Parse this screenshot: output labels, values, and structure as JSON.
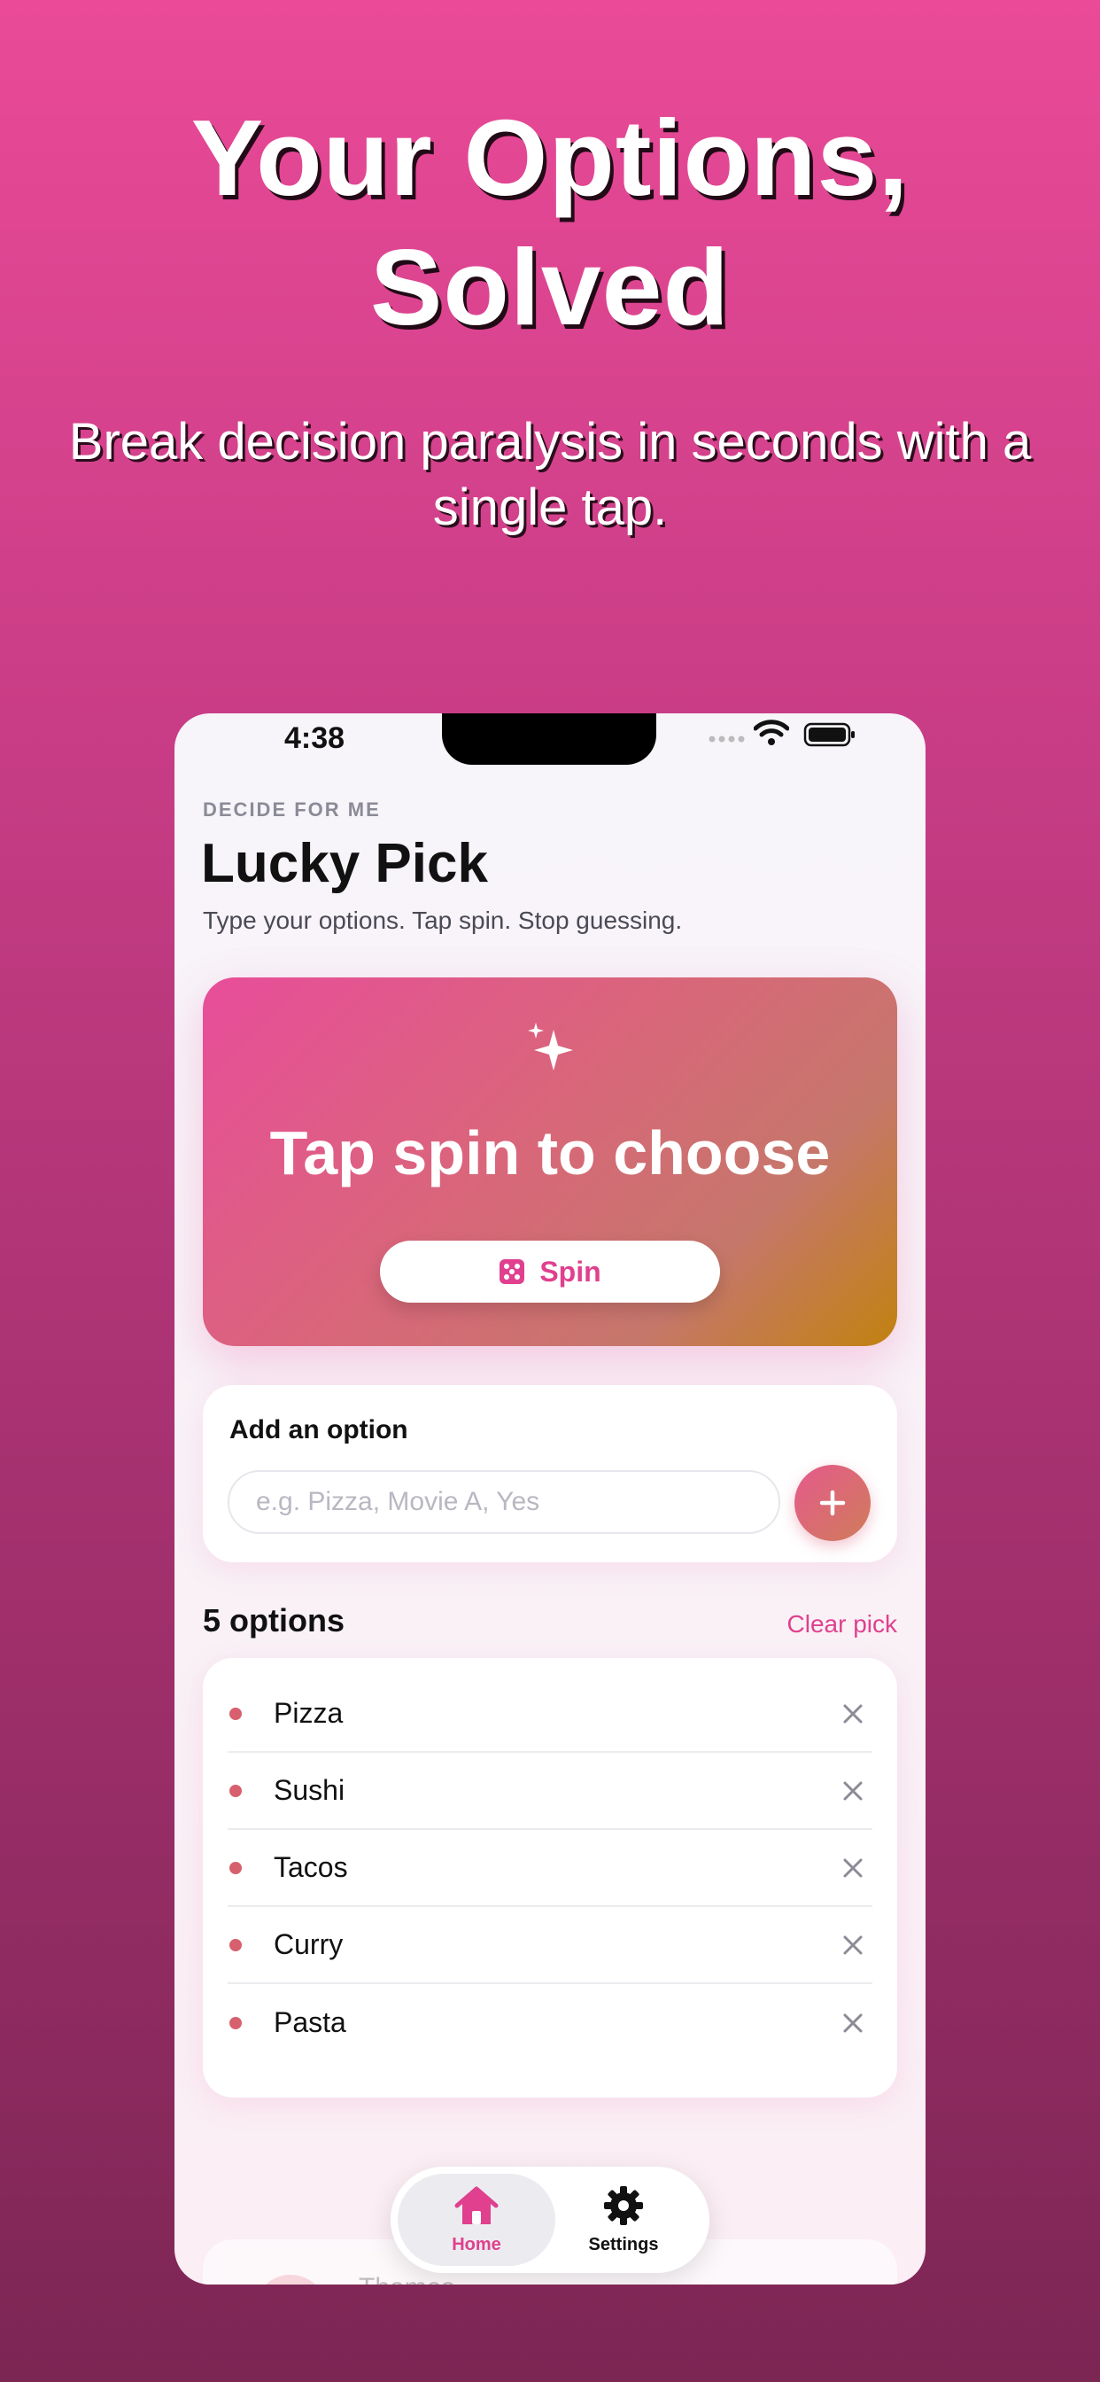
{
  "marketing": {
    "headline_line1": "Your Options,",
    "headline_line2": "Solved",
    "subhead": "Break decision paralysis in seconds with a single tap."
  },
  "status_bar": {
    "time": "4:38"
  },
  "header": {
    "eyebrow": "DECIDE FOR ME",
    "title": "Lucky Pick",
    "subtitle": "Type your options. Tap spin. Stop guessing."
  },
  "spin_card": {
    "prompt": "Tap spin to choose",
    "button_label": "Spin",
    "icon": "sparkle-icon"
  },
  "add_option": {
    "title": "Add an option",
    "placeholder": "e.g. Pizza, Movie A, Yes",
    "value": ""
  },
  "options": {
    "count_label": "5 options",
    "clear_label": "Clear pick",
    "items": [
      {
        "label": "Pizza"
      },
      {
        "label": "Sushi"
      },
      {
        "label": "Tacos"
      },
      {
        "label": "Curry"
      },
      {
        "label": "Pasta"
      }
    ]
  },
  "peek_card": {
    "label": "Themes"
  },
  "tabbar": {
    "items": [
      {
        "label": "Home",
        "icon": "house-icon",
        "active": true
      },
      {
        "label": "Settings",
        "icon": "gear-icon",
        "active": false
      }
    ]
  },
  "colors": {
    "accent": "#e0408e",
    "gradient_start": "#e84d9a",
    "gradient_end": "#c2820f"
  }
}
